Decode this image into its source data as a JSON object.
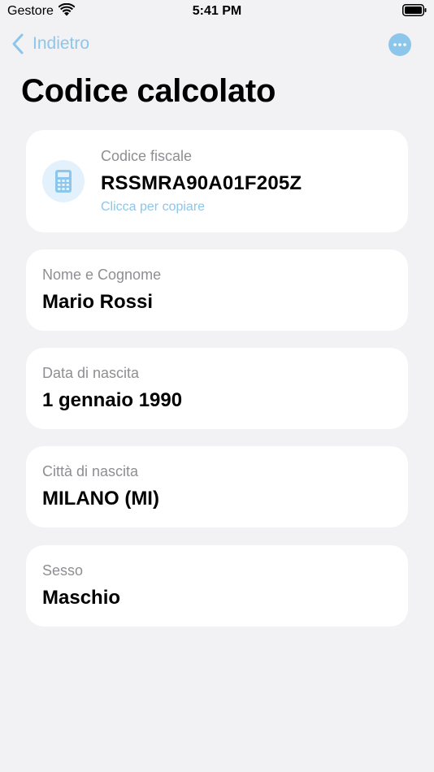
{
  "status_bar": {
    "carrier": "Gestore",
    "time": "5:41 PM"
  },
  "nav": {
    "back_label": "Indietro",
    "back_icon": "chevron-left-icon",
    "more_icon": "ellipsis-icon"
  },
  "title": "Codice calcolato",
  "code_card": {
    "icon": "calculator-icon",
    "label": "Codice fiscale",
    "value": "RSSMRA90A01F205Z",
    "hint": "Clicca per copiare"
  },
  "details": [
    {
      "label": "Nome e Cognome",
      "value": "Mario Rossi"
    },
    {
      "label": "Data di nascita",
      "value": "1 gennaio 1990"
    },
    {
      "label": "Città di nascita",
      "value": "MILANO (MI)"
    },
    {
      "label": "Sesso",
      "value": "Maschio"
    }
  ],
  "colors": {
    "accent": "#8cc6ea",
    "background": "#f2f2f4",
    "card": "#ffffff",
    "secondary_text": "#8e8e93",
    "icon_bg": "#e2f1fb"
  }
}
